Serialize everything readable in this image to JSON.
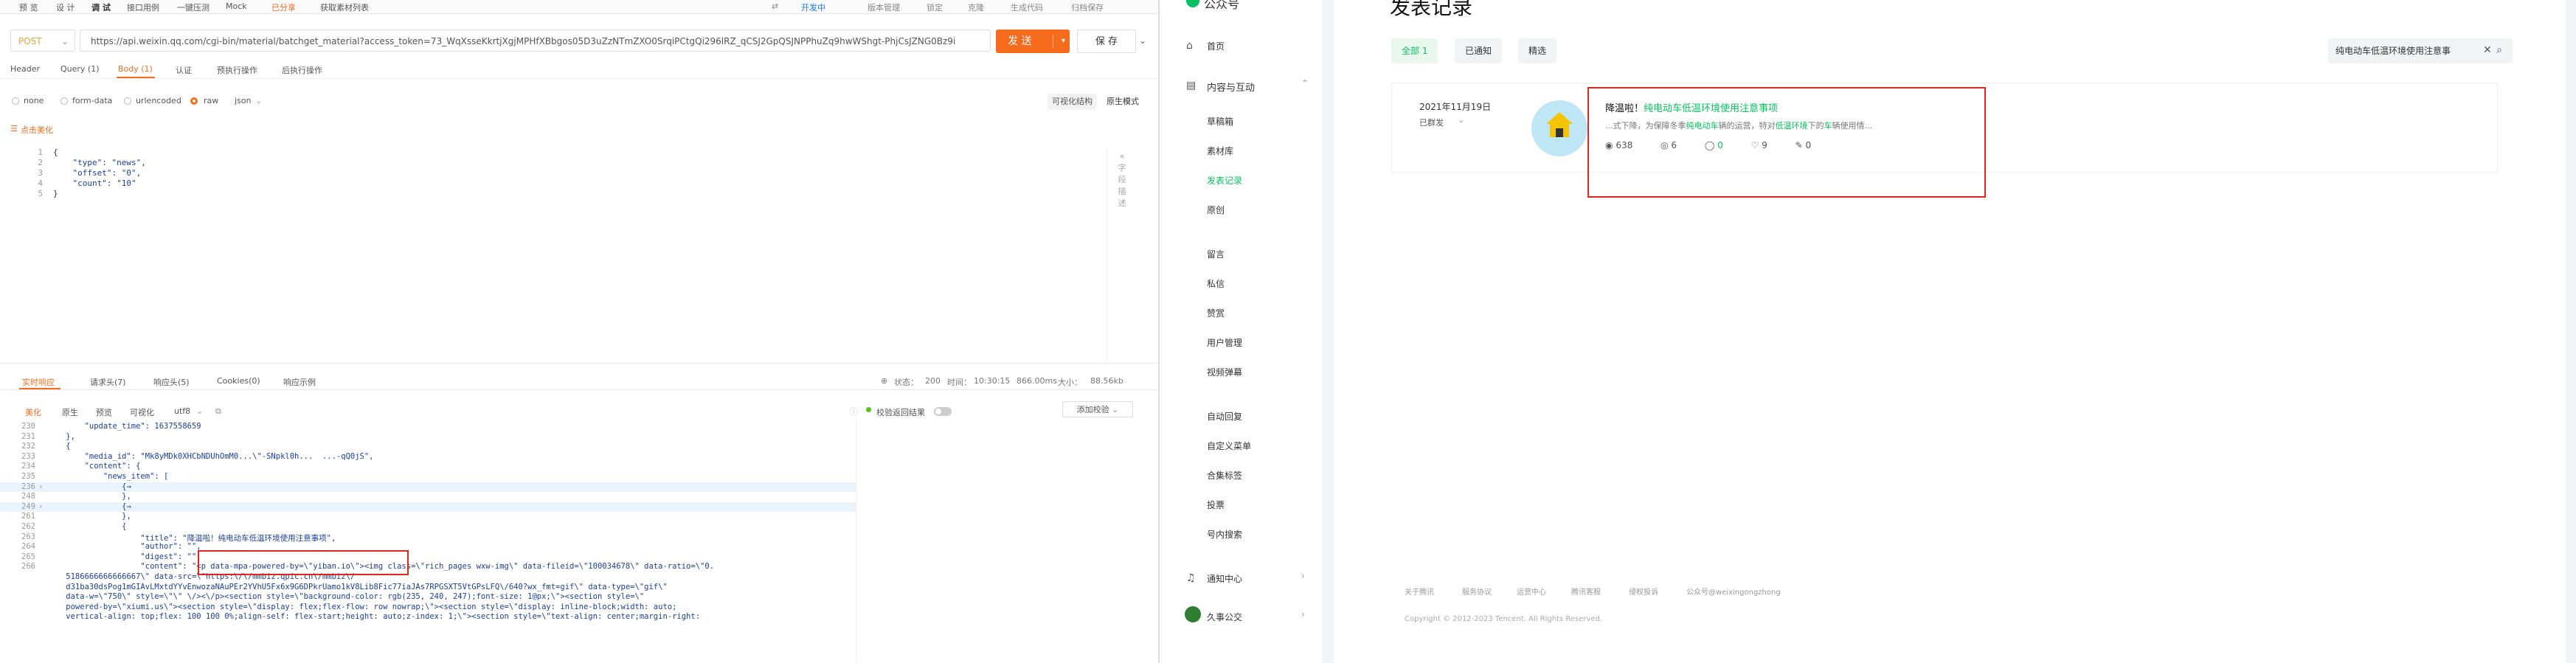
{
  "left": {
    "topbar": {
      "tabs": [
        "预 览",
        "设 计",
        "调 试",
        "接口用例",
        "一键压测",
        "Mock"
      ],
      "doc_tab": "已分享",
      "doc_title": "获取素材列表",
      "tools": [
        "开发中",
        "版本管理",
        "锁定",
        "克隆",
        "生成代码",
        "归档保存"
      ]
    },
    "request": {
      "method": "POST",
      "url": "https://api.weixin.qq.com/cgi-bin/material/batchget_material?access_token=73_WqXsseKkrtjXgjMPHfXBbgos05D3uZzNTmZXO0SrqiPCtgQi296lRZ_qCSJ2GpQSJNPPhuZq9hwWShgt-PhjCsJZNG0Bz9i",
      "send_label": "发 送",
      "save_label": "保 存"
    },
    "req_tabs": [
      "Header",
      "Query (1)",
      "Body (1)",
      "认证",
      "预执行操作",
      "后执行操作"
    ],
    "body_types": [
      "none",
      "form-data",
      "urlencoded",
      "raw",
      "json"
    ],
    "view_modes": [
      "可视化结构",
      "原生模式"
    ],
    "beautify_label": "点击美化",
    "request_body": {
      "line_numbers": [
        "1",
        "2",
        "3",
        "4",
        "5"
      ],
      "lines": [
        "{",
        "    \"type\": \"news\",",
        "    \"offset\": \"0\",",
        "    \"count\": \"10\"",
        "}"
      ]
    },
    "side_help": [
      "字",
      "段",
      "描",
      "述"
    ],
    "response_tabs": [
      "实时响应",
      "请求头(7)",
      "响应头(5)",
      "Cookies(0)",
      "响应示例"
    ],
    "response_status": {
      "status_label": "状态：",
      "status": "200",
      "time_label": "时间：",
      "time": "10:30:15",
      "duration": "866.00ms",
      "size_label": "大小：",
      "size": "88.56kb"
    },
    "response_tools": [
      "美化",
      "原生",
      "预览",
      "可视化",
      "utf8"
    ],
    "assert_label": "校验返回结果",
    "assert_button": "添加校验",
    "response_lines": [
      {
        "n": "230",
        "t": "        \"update_time\": 1637558659"
      },
      {
        "n": "231",
        "t": "    },"
      },
      {
        "n": "232",
        "t": "    {"
      },
      {
        "n": "233",
        "t": "        \"media_id\": \"Mk8yMDk0XHCbNDUhOmM0...\\\"-SNpkl0h...  ...-qQ0jS\","
      },
      {
        "n": "234",
        "t": "        \"content\": {"
      },
      {
        "n": "235",
        "t": "            \"news_item\": ["
      },
      {
        "n": "236",
        "t": "                {→"
      },
      {
        "n": "248",
        "t": "                },"
      },
      {
        "n": "249",
        "t": "                {→"
      },
      {
        "n": "261",
        "t": "                },"
      },
      {
        "n": "262",
        "t": "                {"
      },
      {
        "n": "263",
        "t": "                    \"title\": \"降温啦！纯电动车低温环境使用注意事项\","
      },
      {
        "n": "264",
        "t": "                    \"author\": \"\","
      },
      {
        "n": "265",
        "t": "                    \"digest\": \"\","
      },
      {
        "n": "266",
        "t": "                    \"content\": \"<p data-mpa-powered-by=\\\"yiban.io\\\"><img class=\\\"rich_pages wxw-img\\\" data-fileid=\\\"100034678\\\" data-ratio=\\\"0."
      },
      {
        "n": "",
        "t": "    5186666666666667\\\" data-src=\\\"https:\\/\\/mmbiz.qpic.cn\\/mmbiz\\/"
      },
      {
        "n": "",
        "t": "    d31ba30dsPog1mGIAvLMxtdYYvEnwozaNAuPEr2YVhU5Fx6x9G6DPkrUamo1kV8Lib8Fic77iaJAs7RPGSXT5VtGPsLFQ\\/640?wx_fmt=gif\\\" data-type=\\\"gif\\\""
      },
      {
        "n": "",
        "t": "    data-w=\\\"750\\\" style=\\\"\\\" \\/><\\/p><section style=\\\"background-color: rgb(235, 240, 247);font-size: 1@px;\\\"><section style=\\\""
      },
      {
        "n": "",
        "t": "    powered-by=\\\"xiumi.us\\\"><section style=\\\"display: flex;flex-flow: row nowrap;\\\"><section style=\\\"display: inline-block;width: auto;"
      },
      {
        "n": "",
        "t": "    vertical-align: top;flex: 100 100 0%;align-self: flex-start;height: auto;z-index: 1;\\\"><section style=\\\"text-align: center;margin-right:"
      }
    ]
  },
  "right": {
    "brand": "公众号",
    "page_title": "发表记录",
    "sidebar": {
      "home": "首页",
      "content_group": "内容与互动",
      "content_items": [
        "草稿箱",
        "素材库",
        "发表记录",
        "原创"
      ],
      "other_items": [
        "留言",
        "私信",
        "赞赏",
        "用户管理",
        "视频弹幕"
      ],
      "more_items": [
        "自动回复",
        "自定义菜单",
        "合集标签",
        "投票",
        "号内搜索"
      ],
      "notice": "通知中心",
      "account": "久事公交"
    },
    "filters": [
      "全部 1",
      "已通知",
      "精选"
    ],
    "search_value": "纯电动车低温环境使用注意事",
    "post": {
      "date": "2021年11月19日",
      "status": "已群发",
      "title_prefix": "降温啦！",
      "title_link": "纯电动车低温环境使用注意事项",
      "summary_a": "...式下降，为保障冬季",
      "summary_b": "纯电动车",
      "summary_c": "辆的运营，特对",
      "summary_d": "低温环境",
      "summary_e": "下的",
      "summary_f": "车",
      "summary_g": "辆使用情...",
      "stats": {
        "reads": "638",
        "shares": "6",
        "comments": "0",
        "likes": "9",
        "wow": "0"
      }
    },
    "footer_links": [
      "关于腾讯",
      "服务协议",
      "运营中心",
      "腾讯客服",
      "侵权投诉",
      "公众号@weixingongzhong"
    ],
    "copyright": "Copyright © 2012-2023 Tencent. All Rights Reserved.",
    "colors": {
      "accent": "#07c160",
      "highlight_box": "#e0261c"
    }
  }
}
